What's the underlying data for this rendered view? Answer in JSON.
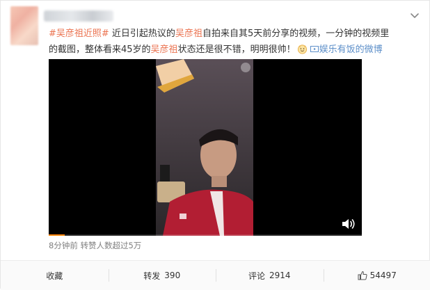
{
  "post": {
    "hashtag": "#吴彦祖近照#",
    "seg1": " 近日引起热议的",
    "kw1": "吴彦祖",
    "seg2": "自拍来自其5天前分享的视频，一分钟的视频里的截图，整体看来45岁的",
    "kw2": "吴彦祖",
    "seg3": "状态还是很不错，明明很帅！",
    "source_label": "娱乐有饭的微博视频"
  },
  "video": {
    "progress_percent": 5
  },
  "meta": {
    "time": "8分钟前",
    "reposts_note": "转赞人数超过5万"
  },
  "actions": {
    "favorite_label": "收藏",
    "repost_label": "转发",
    "repost_count": "390",
    "comment_label": "评论",
    "comment_count": "2914",
    "like_count": "54497"
  },
  "colors": {
    "link_orange": "#eb7350",
    "link_blue": "#5d8fc9",
    "progress": "#ff8200"
  },
  "icons": [
    "chevron-down-icon",
    "emoji-smile-icon",
    "video-link-icon",
    "speaker-icon",
    "thumbs-up-icon"
  ]
}
